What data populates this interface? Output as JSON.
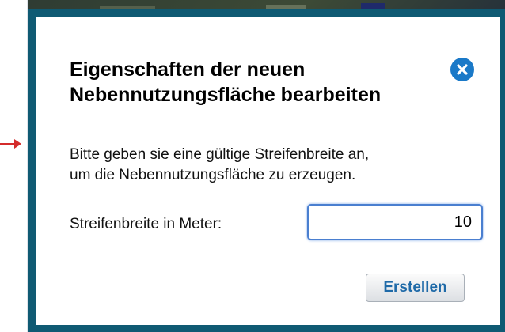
{
  "dialog": {
    "title_line1": "Eigenschaften der neuen",
    "title_line2": "Nebennutzungsfläche bearbeiten",
    "close_icon": "close-icon",
    "message_line1": "Bitte geben sie eine gültige Streifenbreite an,",
    "message_line2": "um die Nebennutzungsfläche zu erzeugen.",
    "width_label": "Streifenbreite in Meter:",
    "width_value": "10",
    "create_label": "Erstellen"
  },
  "colors": {
    "dialog_border": "#0f5a73",
    "close_button": "#1a79c8",
    "input_focus_border": "#4a7fd0",
    "button_text": "#1f6aa8",
    "pointer_arrow": "#d42b2b"
  }
}
